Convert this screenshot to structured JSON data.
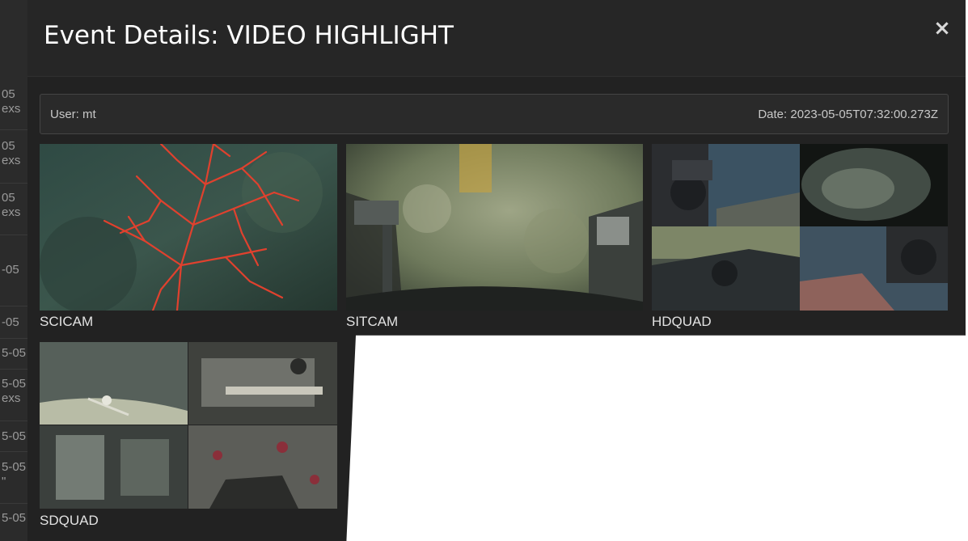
{
  "background_page": {
    "rows": [
      {
        "line1": "05",
        "line2": "exs"
      },
      {
        "line1": "05",
        "line2": "exs"
      },
      {
        "line1": "05",
        "line2": "exs"
      },
      {
        "line1": "-05",
        "line2": ""
      },
      {
        "line1": "-05",
        "line2": ""
      },
      {
        "line1": "5-05",
        "line2": ""
      },
      {
        "line1": "5-05",
        "line2": "exs"
      },
      {
        "line1": "5-05",
        "line2": ""
      },
      {
        "line1": "5-05",
        "line2": "\""
      },
      {
        "line1": "5-05",
        "line2": ""
      }
    ]
  },
  "modal": {
    "title": "Event Details: VIDEO HIGHLIGHT",
    "close_icon": "close-icon",
    "close_glyph": "×",
    "user_label": "User: mt",
    "date_label": "Date: 2023-05-05T07:32:00.273Z"
  },
  "cameras": [
    {
      "label": "SCICAM",
      "image": "red-coral-underwater"
    },
    {
      "label": "SITCAM",
      "image": "rocky-seafloor-with-manipulators"
    },
    {
      "label": "HDQUAD",
      "image": "four-panel-rov-views"
    },
    {
      "label": "SDQUAD",
      "image": "four-panel-sd-views"
    }
  ],
  "colors": {
    "modal_bg": "#222222",
    "header_bg": "#262626",
    "text": "#ffffff",
    "muted_text": "#c8c8c8"
  }
}
